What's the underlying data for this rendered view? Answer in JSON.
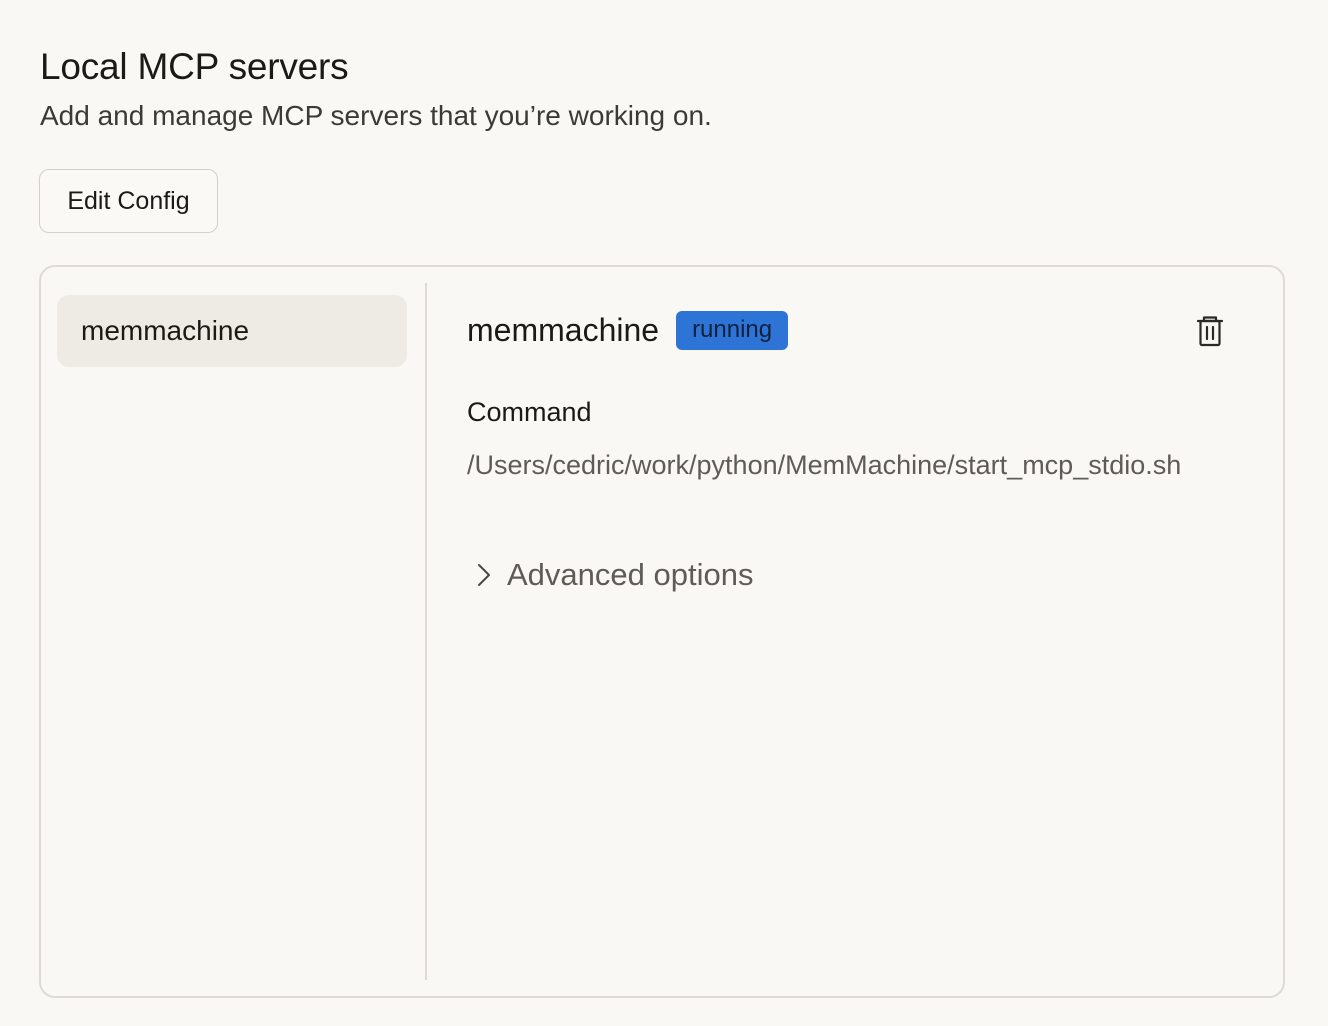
{
  "header": {
    "title": "Local MCP servers",
    "subtitle": "Add and manage MCP servers that you’re working on."
  },
  "toolbar": {
    "edit_config_label": "Edit Config"
  },
  "sidebar": {
    "items": [
      {
        "label": "memmachine",
        "selected": true
      }
    ]
  },
  "detail": {
    "name": "memmachine",
    "status": "running",
    "status_color": "#2e74d6",
    "command_label": "Command",
    "command_value": "/Users/cedric/work/python/MemMachine/start_mcp_stdio.sh",
    "advanced_label": "Advanced options",
    "icons": {
      "delete": "trash-icon",
      "expand": "chevron-right-icon"
    }
  }
}
